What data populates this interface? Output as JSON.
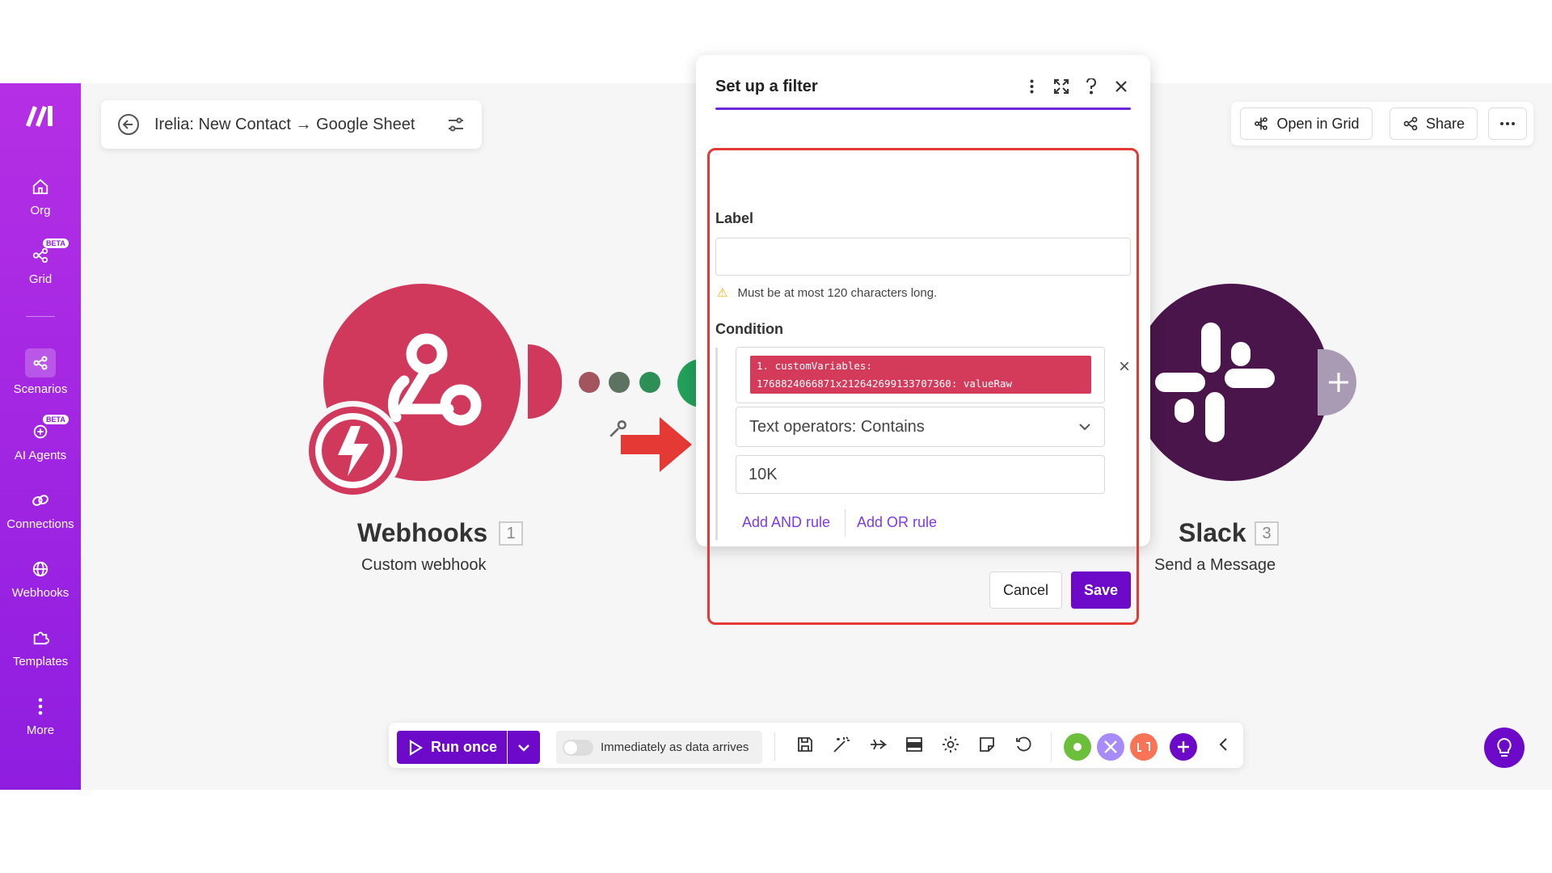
{
  "sidebar": {
    "items": [
      {
        "label": "Org",
        "icon": "home-icon"
      },
      {
        "label": "Grid",
        "icon": "grid-icon",
        "badge": "BETA"
      },
      {
        "label": "Scenarios",
        "icon": "scenarios-icon"
      },
      {
        "label": "AI Agents",
        "icon": "ai-agents-icon",
        "badge": "BETA"
      },
      {
        "label": "Connections",
        "icon": "link-icon"
      },
      {
        "label": "Webhooks",
        "icon": "globe-icon"
      },
      {
        "label": "Templates",
        "icon": "puzzle-icon"
      },
      {
        "label": "More",
        "icon": "more-vertical-icon"
      }
    ]
  },
  "header": {
    "scenario_title": "Irelia: New Contact → Google Sheet",
    "open_in_grid": "Open in Grid",
    "share": "Share"
  },
  "modules": {
    "webhooks": {
      "name": "Webhooks",
      "number": "1",
      "subtitle": "Custom webhook",
      "color": "#d0395b"
    },
    "slack": {
      "name": "Slack",
      "number": "3",
      "subtitle": "Send a Message",
      "color": "#4a154b"
    }
  },
  "filter_dialog": {
    "title": "Set up a filter",
    "label_field": {
      "label": "Label",
      "value": ""
    },
    "hint": "Must be at most 120 characters long.",
    "condition_label": "Condition",
    "chip_line1": "1. customVariables:",
    "chip_line2": "1768824066871x212642699133707360: valueRaw",
    "operator": "Text operators: Contains",
    "value": "10K",
    "add_and": "Add AND rule",
    "add_or": "Add OR rule",
    "cancel": "Cancel",
    "save": "Save"
  },
  "toolbar": {
    "run_once": "Run once",
    "schedule": "Immediately as data arrives",
    "app_bubbles": [
      "#6bbf3b",
      "#a78bfa",
      "#f97356"
    ]
  },
  "colors": {
    "accent": "#6d0ac9",
    "highlight": "#e53935"
  }
}
